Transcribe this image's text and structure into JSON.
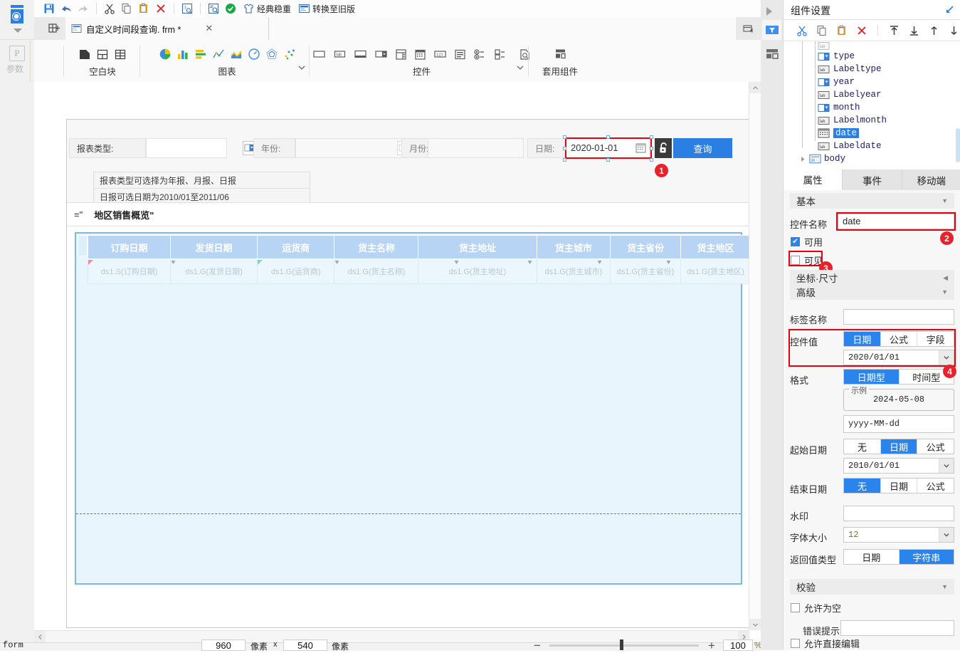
{
  "toolbar": {
    "icons": [
      "save-icon",
      "undo-icon",
      "redo-icon",
      "cut-icon",
      "copy-icon",
      "paste-icon",
      "delete-icon",
      "text-format-icon",
      "preview-icon",
      "validate-icon"
    ],
    "theme_label": "经典稳重",
    "convert_label": "转换至旧版"
  },
  "tabbar": {
    "tab_title": "自定义时间段查询. frm *",
    "close_label": "✕"
  },
  "ribbon": {
    "param_box": "P",
    "param_label": "参数",
    "groups": [
      {
        "name": "空白块",
        "icons": [
          "blank-block-icon",
          "split-block-icon",
          "grid-block-icon"
        ]
      },
      {
        "name": "图表",
        "icons": [
          "pie-chart-icon",
          "column-chart-icon",
          "bar-chart-icon",
          "line-chart-icon",
          "area-chart-icon",
          "gauge-chart-icon",
          "radar-chart-icon",
          "scatter-chart-icon"
        ]
      },
      {
        "name": "控件",
        "icons": [
          "text-widget-icon",
          "label-widget-icon",
          "textarea-widget-icon",
          "combobox-widget-icon",
          "datetime-widget-icon",
          "calendar-widget-icon",
          "number-widget-icon",
          "list-widget-icon",
          "radio-widget-icon",
          "checkbox-widget-icon",
          "preview-widget-icon"
        ]
      },
      {
        "name": "套用组件",
        "icons": [
          "apply-component-icon"
        ]
      }
    ]
  },
  "form": {
    "pixel_tags": {
      "left": "23像素",
      "top": "698像素"
    },
    "query_row": {
      "report_type_label": "报表类型:",
      "report_type_value": "",
      "year_label": "年份:",
      "year_value": "",
      "month_label": "月份:",
      "month_value": "",
      "date_label": "日期:",
      "date_value": "2020-01-01",
      "search_button": "查询"
    },
    "hints": [
      "报表类型可选择为年报、月报、日报",
      "日报可选日期为2010/01至2011/06"
    ],
    "title_formula": "=\"",
    "title_text": "地区销售概览\"",
    "table": {
      "headers": [
        "订购日期",
        "发货日期",
        "运货商",
        "货主名称",
        "货主地址",
        "货主城市",
        "货主省份",
        "货主地区"
      ],
      "cells": [
        "ds1.S(订购日期)",
        "ds1.G(发货日期)",
        "ds1.G(运货商)",
        "ds1.G(货主名称)",
        "ds1.G(货主地址)",
        "ds1.G(货主城市)",
        "ds1.G(货主省份)",
        "ds1.G(货主地区)"
      ]
    }
  },
  "badges": {
    "one": "1",
    "two": "2",
    "three": "3",
    "four": "4"
  },
  "status": {
    "form_label": "form",
    "width": "960",
    "unit1": "像素",
    "times": "x",
    "height": "540",
    "unit2": "像素",
    "zoom_minus": "−",
    "zoom_plus": "+",
    "zoom_value": "100",
    "zoom_percent": "%"
  },
  "panel": {
    "header_title": "组件设置",
    "tools": [
      "cut-icon",
      "copy-icon",
      "paste-icon",
      "delete-icon",
      "move-top-icon",
      "move-bottom-icon",
      "move-up-icon",
      "move-down-icon"
    ],
    "tree": [
      {
        "label": "type",
        "icon": "combobox-icon",
        "selected": false
      },
      {
        "label": "Labeltype",
        "icon": "label-icon",
        "selected": false
      },
      {
        "label": "year",
        "icon": "combobox-icon",
        "selected": false
      },
      {
        "label": "Labelyear",
        "icon": "label-icon",
        "selected": false
      },
      {
        "label": "month",
        "icon": "combobox-icon",
        "selected": false
      },
      {
        "label": "Labelmonth",
        "icon": "label-icon",
        "selected": false
      },
      {
        "label": "date",
        "icon": "calendar-icon",
        "selected": true
      },
      {
        "label": "Labeldate",
        "icon": "label-icon",
        "selected": false
      },
      {
        "label": "body",
        "icon": "body-icon",
        "selected": false
      }
    ],
    "tabs": [
      {
        "label": "属性",
        "active": true
      },
      {
        "label": "事件",
        "active": false
      },
      {
        "label": "移动端",
        "active": false
      }
    ],
    "sections": {
      "basic": "基本",
      "coord_size": "坐标·尺寸",
      "advanced": "高级",
      "validation": "校验"
    },
    "props": {
      "widget_name_label": "控件名称",
      "widget_name_value": "date",
      "enabled_label": "可用",
      "enabled_checked": true,
      "visible_label": "可见",
      "visible_checked": false,
      "tag_name_label": "标签名称",
      "tag_name_value": "",
      "widget_value_label": "控件值",
      "widget_value_segs": [
        "日期",
        "公式",
        "字段"
      ],
      "widget_value_active": 0,
      "widget_value_date": "2020/01/01",
      "format_label": "格式",
      "format_segs": [
        "日期型",
        "时间型"
      ],
      "format_active": 0,
      "example_legend": "示例",
      "example_value": "2024-05-08",
      "pattern_value": "yyyy-MM-dd",
      "start_date_label": "起始日期",
      "start_date_segs": [
        "无",
        "日期",
        "公式"
      ],
      "start_date_active": 1,
      "start_date_value": "2010/01/01",
      "end_date_label": "结束日期",
      "end_date_segs": [
        "无",
        "日期",
        "公式"
      ],
      "end_date_active": 0,
      "watermark_label": "水印",
      "watermark_value": "",
      "font_size_label": "字体大小",
      "font_size_value": "12",
      "return_type_label": "返回值类型",
      "return_type_segs": [
        "日期",
        "字符串"
      ],
      "return_type_active": 1,
      "allow_empty_label": "允许为空",
      "allow_empty_checked": false,
      "error_tip_label": "错误提示",
      "error_tip_value": "",
      "allow_direct_edit_label": "允许直接编辑",
      "allow_direct_edit_checked": false
    }
  },
  "colors": {
    "accent": "#2b7fe3",
    "red": "#e8000d",
    "header_blue": "#b8d4f5",
    "table_bg": "#e9f5fd"
  }
}
